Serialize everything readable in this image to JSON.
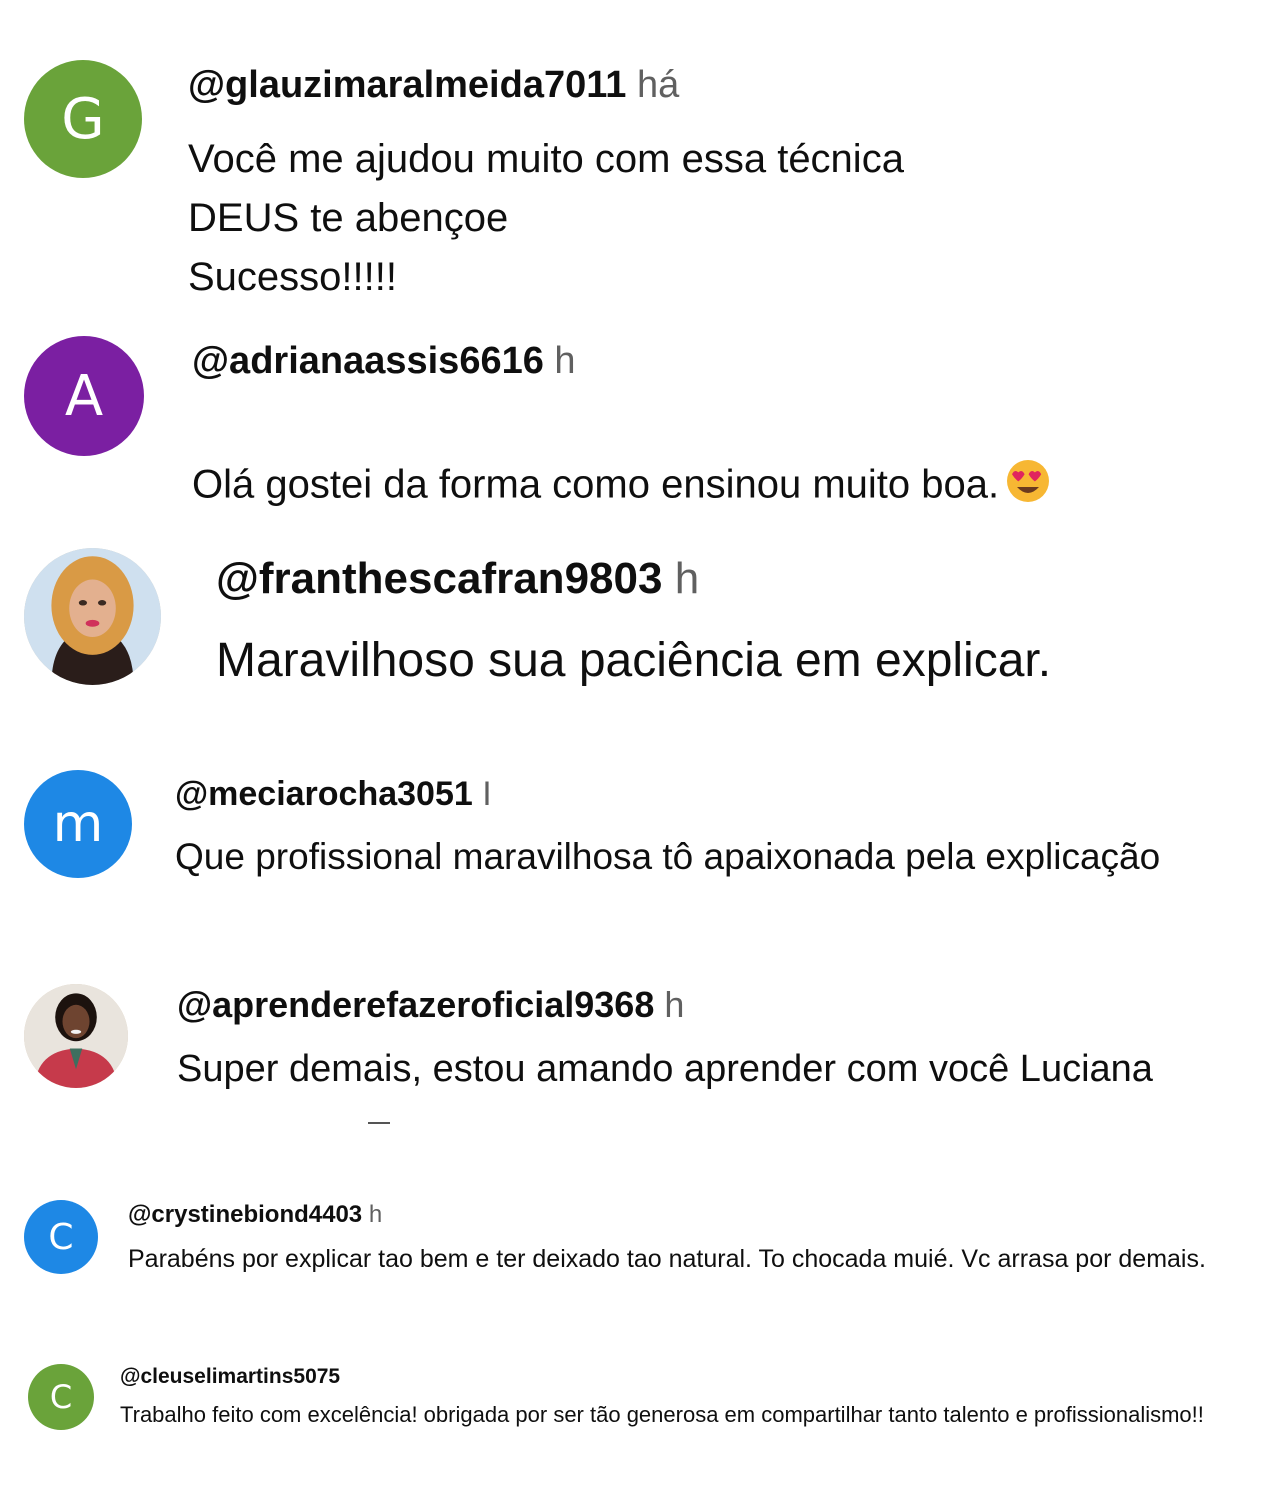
{
  "comments": [
    {
      "handle": "@glauzimaralmeida7011",
      "time": "há",
      "text": "Você me ajudou muito  com essa técnica\nDEUS te abençoe\nSucesso!!!!!",
      "avatar": {
        "letter": "G",
        "color": "#6aa33a"
      }
    },
    {
      "handle": "@adrianaassis6616",
      "time": "h",
      "text": "Olá gostei da forma como ensinou muito boa.",
      "emoji": "heart-eyes-emoji",
      "avatar": {
        "letter": "A",
        "color": "#7b1fa2"
      }
    },
    {
      "handle": "@franthescafran9803",
      "time": "h",
      "text": "Maravilhoso sua paciência em explicar.",
      "avatar": {
        "type": "photo"
      }
    },
    {
      "handle": "@meciarocha3051",
      "time": "I",
      "text": "Que profissional maravilhosa tô apaixonada pela explicação",
      "avatar": {
        "letter": "m",
        "color": "#1e88e5"
      }
    },
    {
      "handle": "@aprenderefazeroficial9368",
      "time": "h",
      "text": "Super demais, estou amando aprender com você Luciana",
      "avatar": {
        "type": "photo"
      }
    },
    {
      "handle": "@crystinebiond4403",
      "time": "h",
      "text": "Parabéns por explicar tao bem e ter deixado tao natural. To chocada muié. Vc arrasa por demais.",
      "avatar": {
        "letter": "C",
        "color": "#1e88e5"
      }
    },
    {
      "handle": "@cleuselimartins5075",
      "time": "",
      "text": "Trabalho feito com excelência! obrigada por ser tão generosa em compartilhar tanto talento e profissionalismo!!",
      "avatar": {
        "letter": "C",
        "color": "#6aa33a"
      }
    }
  ]
}
